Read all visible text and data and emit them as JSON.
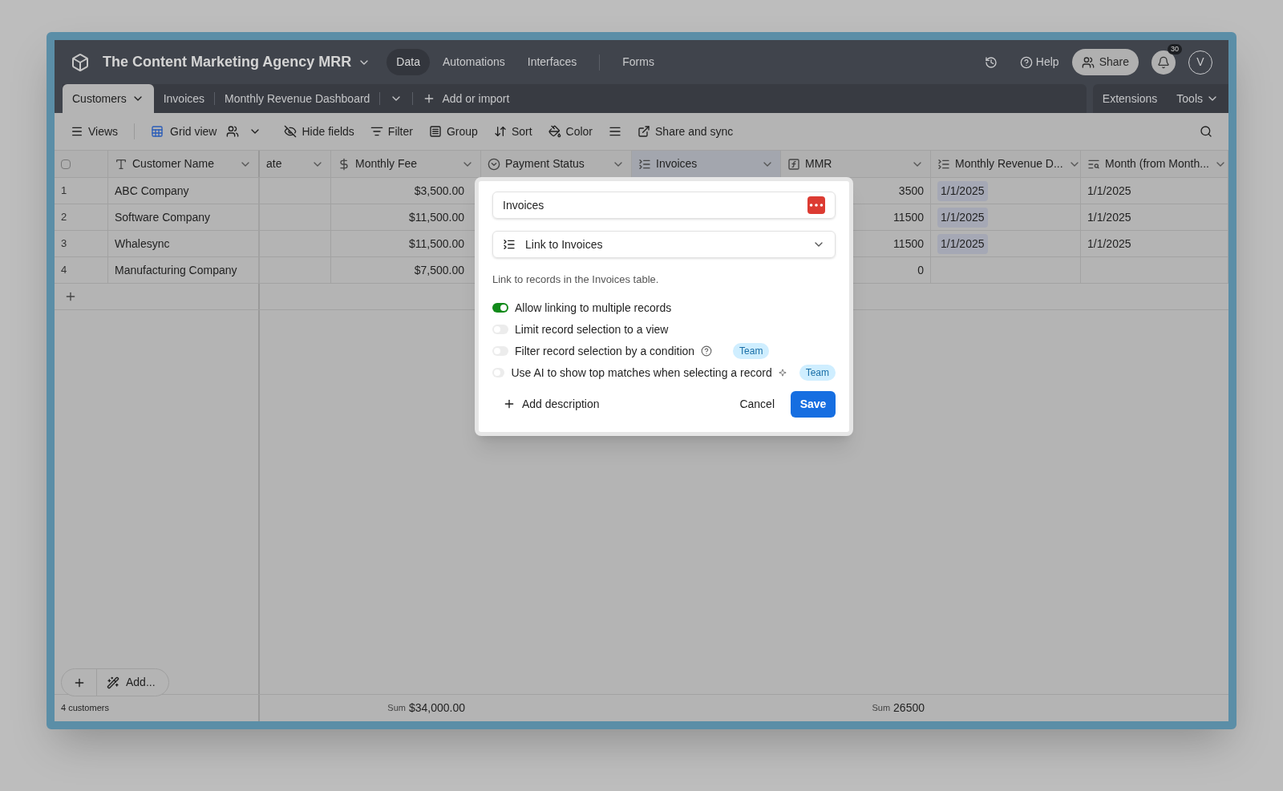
{
  "base": {
    "title": "The Content Marketing Agency MRR"
  },
  "nav": [
    {
      "label": "Data",
      "selected": true
    },
    {
      "label": "Automations",
      "selected": false
    },
    {
      "label": "Interfaces",
      "selected": false
    },
    {
      "label": "Forms",
      "selected": false
    }
  ],
  "header_actions": {
    "help": "Help",
    "share": "Share",
    "notifications": "30",
    "avatar": "V"
  },
  "tables": [
    {
      "label": "Customers",
      "selected": true
    },
    {
      "label": "Invoices",
      "selected": false
    },
    {
      "label": "Monthly Revenue Dashboard",
      "selected": false
    }
  ],
  "add_table": "Add or import",
  "tab_actions": {
    "extensions": "Extensions",
    "tools": "Tools"
  },
  "toolbar": [
    {
      "kind": "views",
      "label": "Views"
    },
    {
      "kind": "grid",
      "label": "Grid view"
    },
    {
      "kind": "hide",
      "label": "Hide fields"
    },
    {
      "kind": "filter",
      "label": "Filter"
    },
    {
      "kind": "group",
      "label": "Group"
    },
    {
      "kind": "sort",
      "label": "Sort"
    },
    {
      "kind": "color",
      "label": "Color"
    },
    {
      "kind": "height"
    },
    {
      "kind": "share",
      "label": "Share and sync"
    }
  ],
  "select_all": {
    "checked": false
  },
  "columns": [
    {
      "kind": "text",
      "label": "Customer Name",
      "selected": false
    },
    {
      "kind": "cut",
      "label": "ate",
      "selected": false
    },
    {
      "kind": "currency",
      "label": "Monthly Fee",
      "selected": false
    },
    {
      "kind": "status",
      "label": "Payment Status",
      "selected": false
    },
    {
      "kind": "link",
      "label": "Invoices",
      "selected": true
    },
    {
      "kind": "formula",
      "label": "MMR",
      "selected": false
    },
    {
      "kind": "link",
      "label": "Monthly Revenue D...",
      "selected": false
    },
    {
      "kind": "lookup",
      "label": "Month (from Month...",
      "selected": false
    }
  ],
  "rows": [
    {
      "number": "1",
      "name": "ABC Company",
      "fee": "$3,500.00",
      "mmr": "3500",
      "revenue": "1/1/2025",
      "month": "1/1/2025"
    },
    {
      "number": "2",
      "name": "Software Company",
      "fee": "$11,500.00",
      "mmr": "11500",
      "revenue": "1/1/2025",
      "month": "1/1/2025"
    },
    {
      "number": "3",
      "name": "Whalesync",
      "fee": "$11,500.00",
      "mmr": "11500",
      "revenue": "1/1/2025",
      "month": "1/1/2025"
    },
    {
      "number": "4",
      "name": "Manufacturing Company",
      "fee": "$7,500.00",
      "mmr": "0"
    }
  ],
  "add_button": "Add...",
  "footer": {
    "count": "4 customers",
    "fee_label": "Sum",
    "fee_sum": "$34,000.00",
    "mmr_label": "Sum",
    "mmr_sum": "26500"
  },
  "dialog": {
    "name": "Invoices",
    "type": "Link to Invoices",
    "description": "Link to records in the Invoices table.",
    "options": [
      {
        "label": "Allow linking to multiple records",
        "on": true
      },
      {
        "label": "Limit record selection to a view",
        "on": false
      },
      {
        "label": "Filter record selection by a condition",
        "on": false,
        "kind": "help",
        "badge": "Team"
      },
      {
        "label": "Use AI to show top matches when selecting a record",
        "on": false,
        "kind": "ai",
        "badge": "Team"
      }
    ],
    "add_description": "Add description",
    "cancel": "Cancel",
    "save": "Save"
  }
}
